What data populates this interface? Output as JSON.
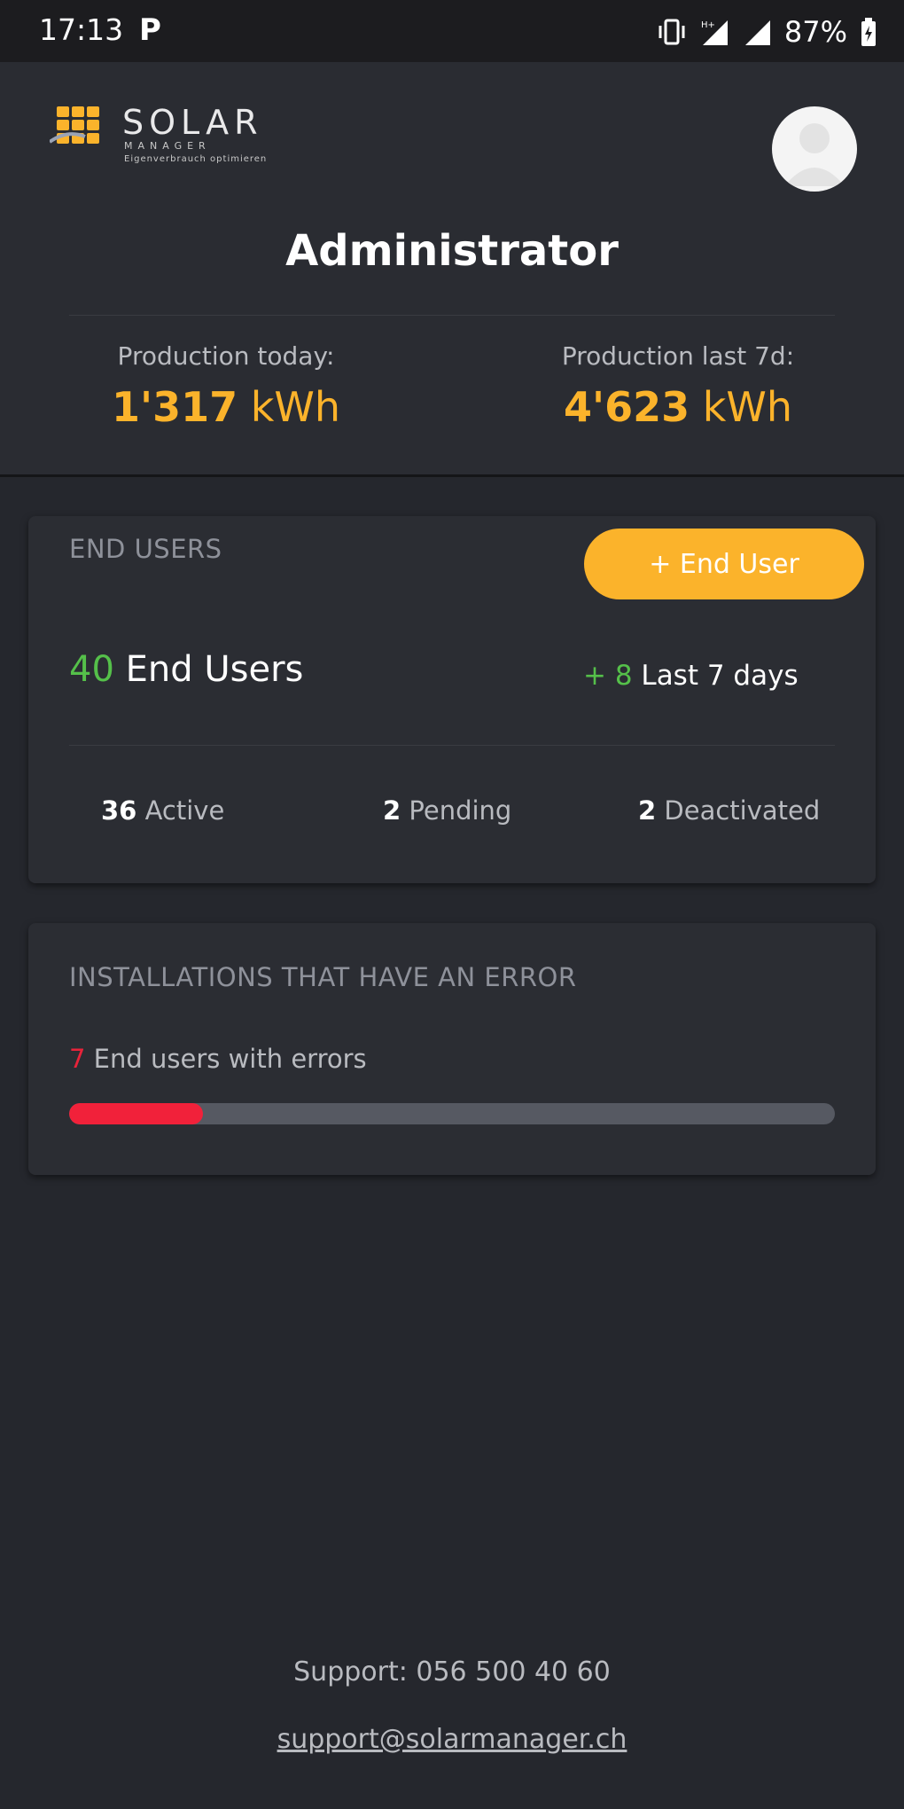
{
  "status_bar": {
    "time": "17:13",
    "battery": "87%",
    "icons": [
      "parking-icon",
      "vibrate-icon",
      "signal-icon",
      "signal-icon",
      "battery-icon"
    ]
  },
  "header": {
    "logo": {
      "title": "SOLAR",
      "subtitle": "MANAGER",
      "tagline": "Eigenverbrauch optimieren"
    },
    "title": "Administrator",
    "production_today": {
      "label": "Production today:",
      "value": "1'317",
      "unit": " kWh"
    },
    "production_7d": {
      "label": "Production last 7d:",
      "value": "4'623",
      "unit": " kWh"
    }
  },
  "end_users_card": {
    "title": "END USERS",
    "add_button": "+ End User",
    "total": {
      "count": "40",
      "label": " End Users"
    },
    "new_last_7": {
      "count": "+ 8",
      "label": " Last 7 days"
    },
    "breakdown": [
      {
        "count": "36",
        "label": " Active"
      },
      {
        "count": "2",
        "label": " Pending"
      },
      {
        "count": "2",
        "label": " Deactivated"
      }
    ]
  },
  "errors_card": {
    "title": "INSTALLATIONS THAT HAVE AN ERROR",
    "count": "7",
    "label": " End users with errors",
    "progress_fraction": 0.175
  },
  "footer": {
    "support_phone": "Support: 056 500 40 60",
    "support_email": "support@solarmanager.ch"
  },
  "colors": {
    "accent": "#fbb32b",
    "positive": "#55c04a",
    "error": "#e8233a",
    "background": "#25272d",
    "card": "#2b2d33"
  }
}
